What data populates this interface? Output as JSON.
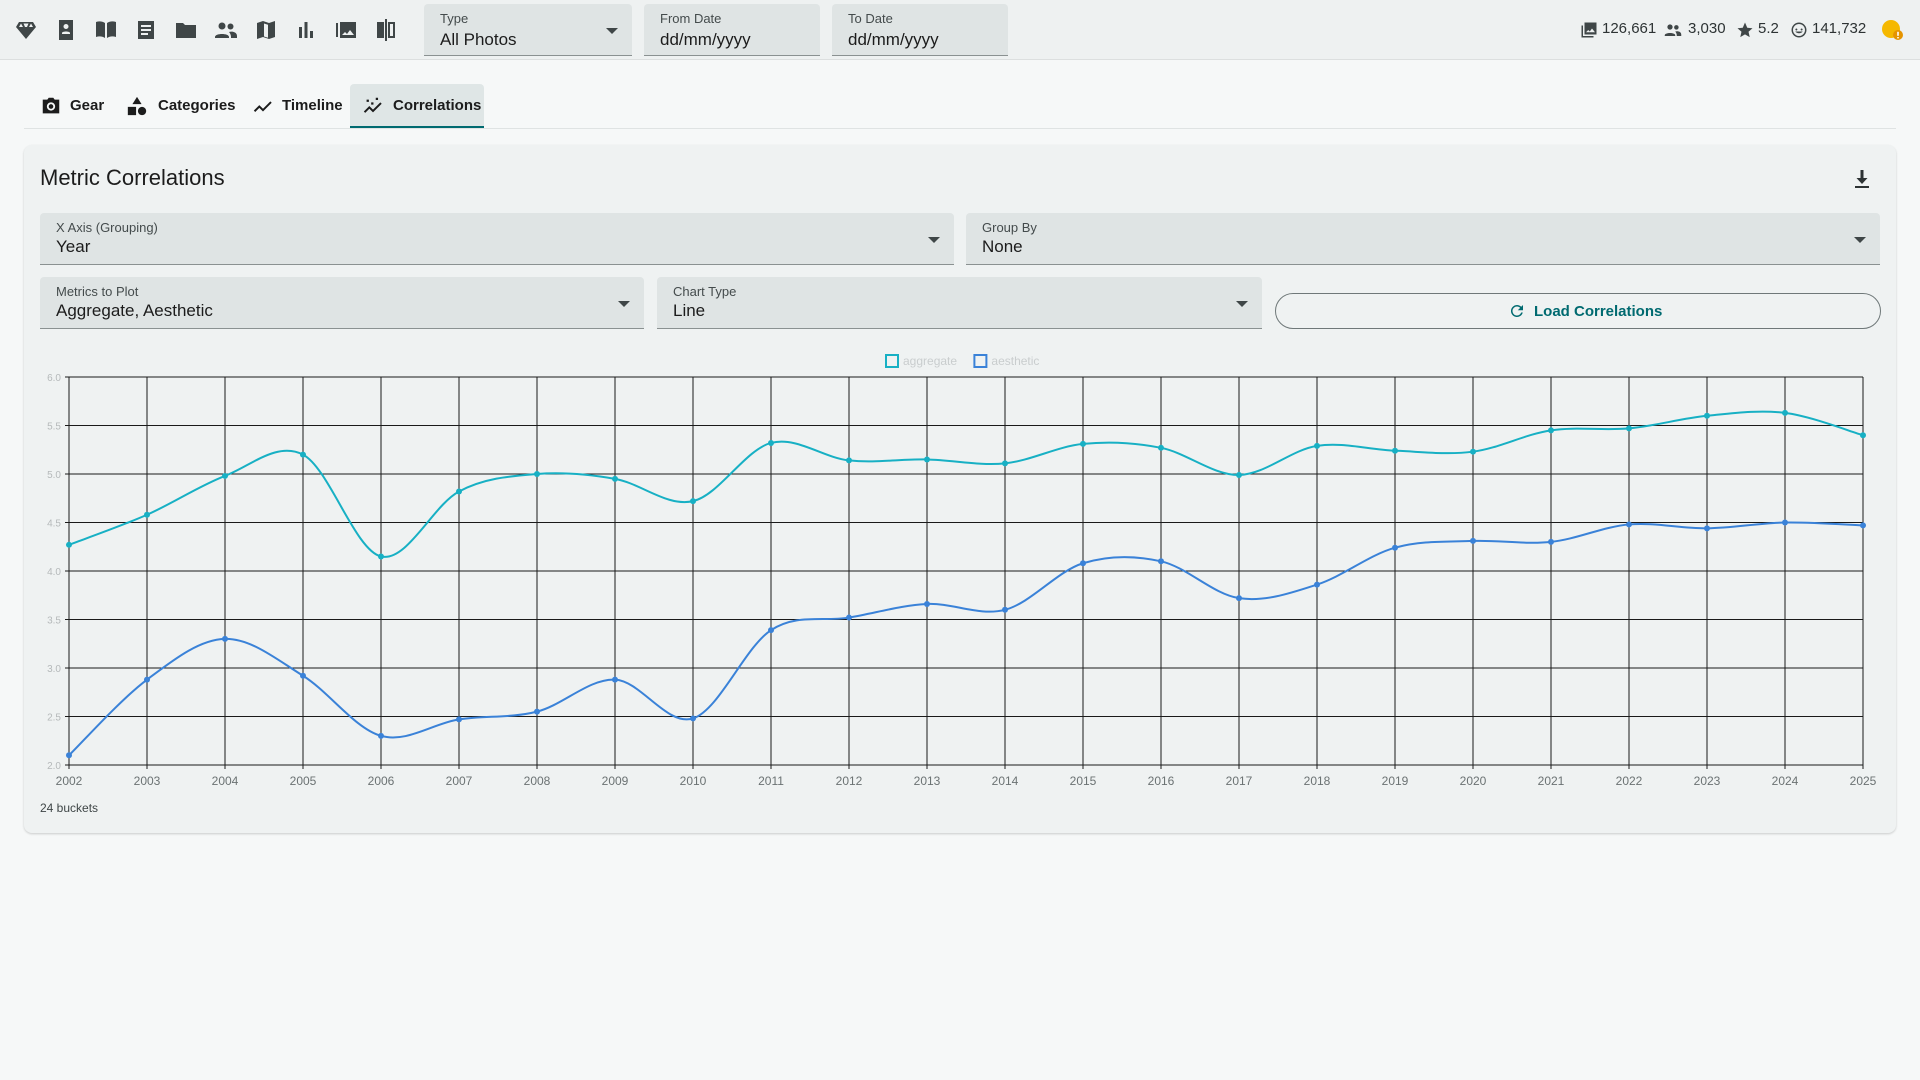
{
  "toolbar": {
    "icons": [
      "diamond-icon",
      "portrait-book-icon",
      "open-book-icon",
      "article-icon",
      "folder-icon",
      "people-icon",
      "map-icon",
      "bar-chart-icon",
      "photo-gallery-icon",
      "compare-icon"
    ],
    "type_filter": {
      "label": "Type",
      "value": "All Photos"
    },
    "from_date": {
      "label": "From Date",
      "value": "dd/mm/yyyy"
    },
    "to_date": {
      "label": "To Date",
      "value": "dd/mm/yyyy"
    },
    "stats": {
      "photos": "126,661",
      "people": "3,030",
      "rating": "5.2",
      "faces": "141,732"
    }
  },
  "tabs": [
    {
      "label": "Gear",
      "icon": "camera-icon"
    },
    {
      "label": "Categories",
      "icon": "shapes-icon"
    },
    {
      "label": "Timeline",
      "icon": "trend-line-icon"
    },
    {
      "label": "Correlations",
      "icon": "scatter-trend-icon",
      "active": true
    }
  ],
  "card": {
    "title": "Metric Correlations",
    "x_axis": {
      "label": "X Axis (Grouping)",
      "value": "Year"
    },
    "group_by": {
      "label": "Group By",
      "value": "None"
    },
    "metrics": {
      "label": "Metrics to Plot",
      "value": "Aggregate, Aesthetic"
    },
    "chart_type": {
      "label": "Chart Type",
      "value": "Line"
    },
    "load_button": "Load Correlations",
    "buckets": "24 buckets"
  },
  "colors": {
    "accent": "#006a70",
    "aggregate": "#17b0c4",
    "aesthetic": "#3a82d8",
    "warning": "#f5b800"
  },
  "chart_data": {
    "type": "line",
    "x": [
      "2002",
      "2003",
      "2004",
      "2005",
      "2006",
      "2007",
      "2008",
      "2009",
      "2010",
      "2011",
      "2012",
      "2013",
      "2014",
      "2015",
      "2016",
      "2017",
      "2018",
      "2019",
      "2020",
      "2021",
      "2022",
      "2023",
      "2024",
      "2025"
    ],
    "yticks": [
      "2.0",
      "2.5",
      "3.0",
      "3.5",
      "4.0",
      "4.5",
      "5.0",
      "5.5",
      "6.0"
    ],
    "ylim": [
      2.0,
      6.0
    ],
    "grid": true,
    "legend": "top-center",
    "series": [
      {
        "name": "aggregate",
        "values": [
          4.27,
          4.58,
          4.98,
          5.2,
          4.15,
          4.82,
          5.0,
          4.95,
          4.72,
          5.32,
          5.14,
          5.15,
          5.11,
          5.31,
          5.27,
          4.99,
          5.29,
          5.24,
          5.23,
          5.45,
          5.47,
          5.6,
          5.63,
          5.4
        ]
      },
      {
        "name": "aesthetic",
        "values": [
          2.1,
          2.88,
          3.3,
          2.92,
          2.3,
          2.47,
          2.55,
          2.88,
          2.48,
          3.39,
          3.52,
          3.66,
          3.6,
          4.08,
          4.1,
          3.72,
          3.86,
          4.24,
          4.31,
          4.3,
          4.48,
          4.44,
          4.5,
          4.47
        ]
      }
    ]
  }
}
